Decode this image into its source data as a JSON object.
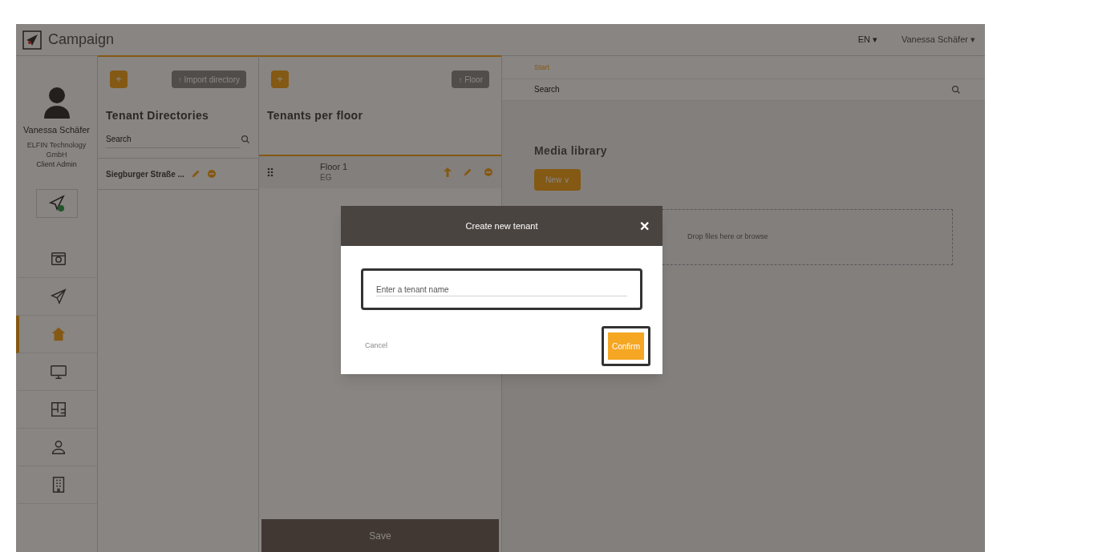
{
  "topbar": {
    "app_name": "Campaign",
    "language": "EN ▾",
    "user": "Vanessa Schäfer ▾"
  },
  "sidebar": {
    "user_name": "Vanessa Schäfer",
    "company": "ELFIN Technology GmbH",
    "role": "Client Admin",
    "items": [
      {
        "kind": "gallery",
        "selected": false
      },
      {
        "kind": "send",
        "selected": false
      },
      {
        "kind": "home",
        "selected": true
      },
      {
        "kind": "monitor",
        "selected": false
      },
      {
        "kind": "floorplan",
        "selected": false
      },
      {
        "kind": "user",
        "selected": false
      },
      {
        "kind": "building",
        "selected": false
      }
    ]
  },
  "directories": {
    "add": "+",
    "import": "↑ Import directory",
    "title": "Tenant Directories",
    "search_placeholder": "Search",
    "rows": [
      {
        "name": "Siegburger Straße ..."
      }
    ]
  },
  "floors": {
    "add": "+",
    "floor_button": "↑ Floor",
    "title": "Tenants per floor",
    "rows": [
      {
        "name": "Floor 1",
        "code": "EG"
      }
    ],
    "save": "Save"
  },
  "media": {
    "breadcrumb": "Start",
    "search_placeholder": "Search",
    "title": "Media library",
    "new_button": "New ∨",
    "drop_text": "Drop files here or browse"
  },
  "dialog": {
    "title": "Create new tenant",
    "close": "✕",
    "placeholder": "Enter a tenant name",
    "cancel": "Cancel",
    "confirm": "Confirm"
  }
}
